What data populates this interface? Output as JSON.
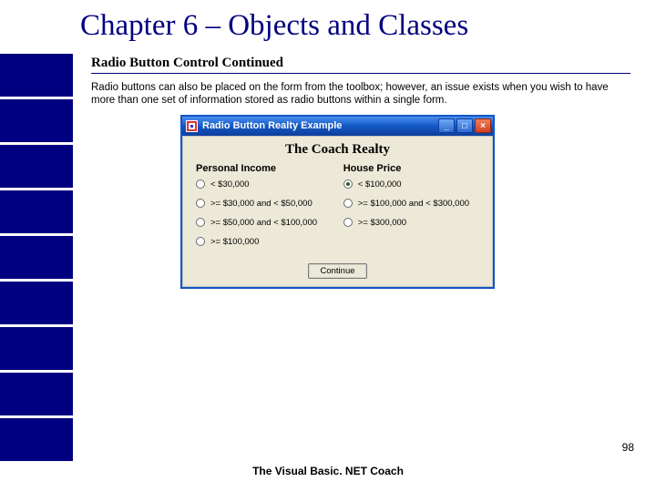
{
  "slide": {
    "chapter_title": "Chapter 6 – Objects and Classes",
    "section_subtitle": "Radio Button Control Continued",
    "body_text": "Radio buttons can also be placed on the form from the toolbox; however, an issue exists when you wish to have more than one set of information stored as radio buttons within a single form.",
    "page_number": "98",
    "footer": "The Visual Basic. NET Coach"
  },
  "window": {
    "title": "Radio Button Realty Example",
    "form_title": "The Coach Realty",
    "group_income": {
      "label": "Personal Income",
      "options": [
        {
          "label": "< $30,000",
          "selected": false
        },
        {
          "label": ">= $30,000 and < $50,000",
          "selected": false
        },
        {
          "label": ">= $50,000 and < $100,000",
          "selected": false
        },
        {
          "label": ">= $100,000",
          "selected": false
        }
      ]
    },
    "group_price": {
      "label": "House Price",
      "options": [
        {
          "label": "< $100,000",
          "selected": true
        },
        {
          "label": ">= $100,000 and < $300,000",
          "selected": false
        },
        {
          "label": ">= $300,000",
          "selected": false
        }
      ]
    },
    "continue_label": "Continue",
    "buttons": {
      "min": "_",
      "max": "□",
      "close": "×"
    }
  }
}
